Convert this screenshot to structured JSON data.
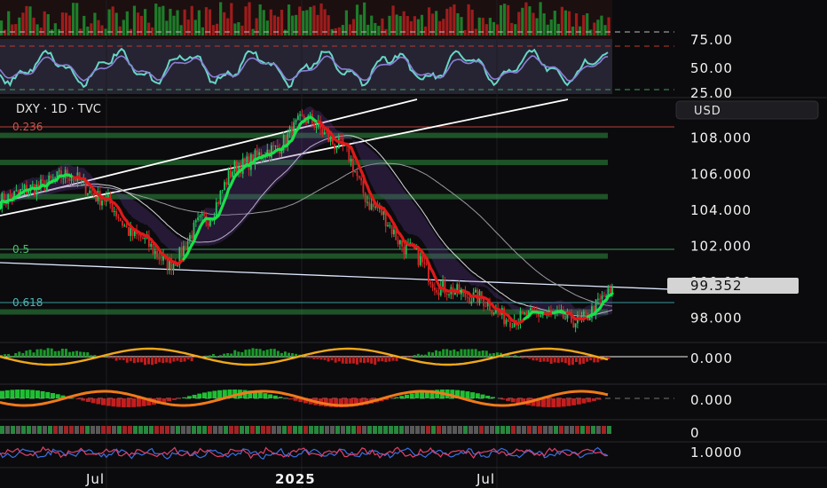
{
  "header": {
    "symbol": "DXY · 1D · TVC"
  },
  "currency_badge": "USD",
  "rsi_panel": {
    "ticks": [
      "75.00",
      "50.00",
      "25.00"
    ]
  },
  "fib_labels": [
    "0.236",
    "0.5",
    "0.618"
  ],
  "osc_panels": {
    "macd_zero": "0.000",
    "wave_zero": "0.000",
    "bars_zero": "0",
    "ratio_label": "1.0000"
  },
  "x_labels": [
    "Jul",
    "2025",
    "Jul"
  ],
  "colors": {
    "up": "#22c55e",
    "down": "#dc2626",
    "bg": "#0b0b0d",
    "price_badge": "#d4d4d4"
  },
  "chart_data": {
    "type": "line",
    "title": "DXY · 1D · TVC",
    "xlabel": "",
    "ylabel": "",
    "ylim": [
      96.8,
      110.2
    ],
    "yticks": [
      108,
      106,
      104,
      102,
      100,
      98
    ],
    "last_price": "99.352",
    "x": [
      "2024-04",
      "2024-05",
      "2024-06",
      "2024-07",
      "2024-08",
      "2024-09",
      "2024-10",
      "2024-11",
      "2024-12",
      "2025-01",
      "2025-02",
      "2025-03",
      "2025-04",
      "2025-05",
      "2025-06",
      "2025-07",
      "2025-08",
      "2025-09",
      "2025-10"
    ],
    "series": [
      {
        "values": [
          104.5,
          105.2,
          105.9,
          104.6,
          102.5,
          101.0,
          103.4,
          106.4,
          107.3,
          109.0,
          107.5,
          104.1,
          101.8,
          99.6,
          99.1,
          97.9,
          98.2,
          97.8,
          99.35
        ]
      }
    ],
    "horizontal_levels": [
      108.1,
      106.6,
      104.7,
      101.4,
      98.3
    ],
    "grid": false,
    "legend": "none"
  }
}
